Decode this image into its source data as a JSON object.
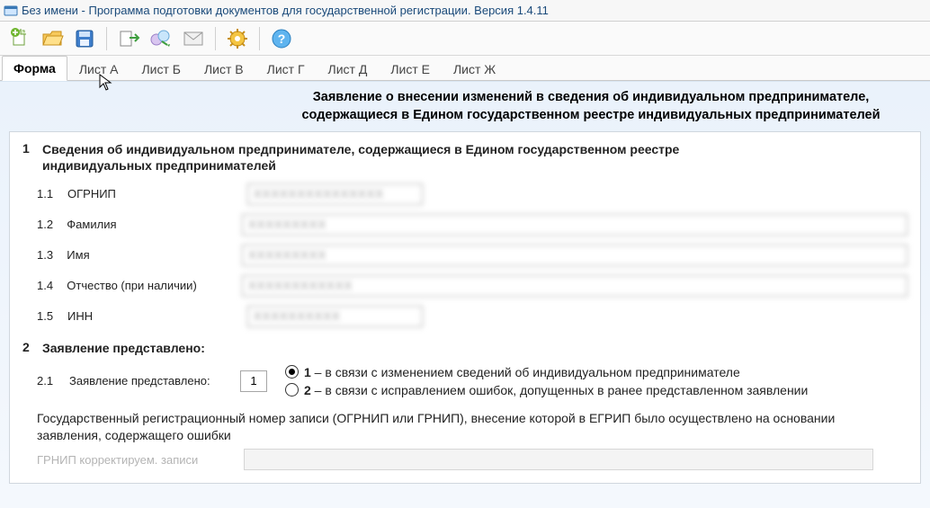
{
  "window": {
    "title": "Без имени - Программа подготовки документов для государственной регистрации. Версия 1.4.11"
  },
  "toolbar": {
    "icons": [
      "new",
      "open",
      "save",
      "export",
      "send",
      "mail",
      "settings",
      "help"
    ]
  },
  "tabs": [
    {
      "label": "Форма",
      "active": true
    },
    {
      "label": "Лист А"
    },
    {
      "label": "Лист Б"
    },
    {
      "label": "Лист В"
    },
    {
      "label": "Лист Г"
    },
    {
      "label": "Лист Д"
    },
    {
      "label": "Лист Е"
    },
    {
      "label": "Лист Ж"
    }
  ],
  "heading": "Заявление о внесении изменений в сведения об индивидуальном предпринимателе, содержащиеся в Едином государственном реестре индивидуальных предпринимателей",
  "section1": {
    "num": "1",
    "title": "Сведения об индивидуальном предпринимателе, содержащиеся в Едином государственном реестре индивидуальных предпринимателей",
    "fields": [
      {
        "num": "1.1",
        "label": "ОГРНИП",
        "value": "XXXXXXXXXXXXXXX",
        "width": "short"
      },
      {
        "num": "1.2",
        "label": "Фамилия",
        "value": "XXXXXXXXX",
        "width": "long"
      },
      {
        "num": "1.3",
        "label": "Имя",
        "value": "XXXXXXXXX",
        "width": "long"
      },
      {
        "num": "1.4",
        "label": "Отчество (при наличии)",
        "value": "XXXXXXXXXXXX",
        "width": "long"
      },
      {
        "num": "1.5",
        "label": "ИНН",
        "value": "XXXXXXXXXX",
        "width": "short"
      }
    ]
  },
  "section2": {
    "num": "2",
    "title": "Заявление представлено:",
    "sub_num": "2.1",
    "sub_label": "Заявление представлено:",
    "value": "1",
    "options": [
      {
        "bold": "1",
        "text": " – в связи с изменением сведений об индивидуальном предпринимателе",
        "selected": true
      },
      {
        "bold": "2",
        "text": " – в связи с исправлением ошибок, допущенных в ранее представленном заявлении",
        "selected": false
      }
    ],
    "paragraph": "Государственный регистрационный номер записи (ОГРНИП или ГРНИП), внесение которой в ЕГРИП  было осуществлено на основании заявления, содержащего ошибки",
    "disabled_label": "ГРНИП корректируем. записи"
  }
}
